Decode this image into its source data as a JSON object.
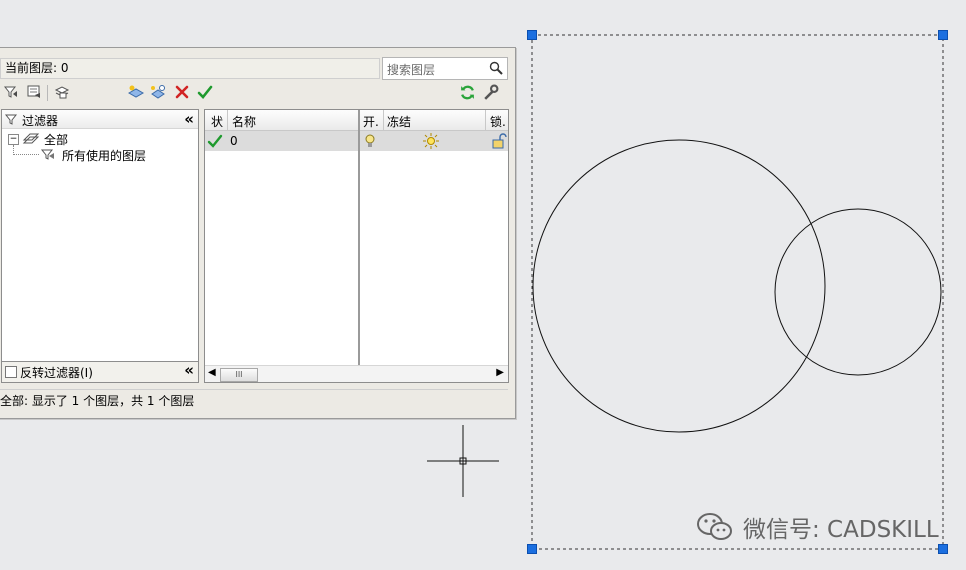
{
  "layer_manager": {
    "current_layer": "当前图层: 0",
    "search_placeholder": "搜索图层",
    "tree": {
      "header": "过滤器",
      "root": "全部",
      "child": "所有使用的图层",
      "invert_label": "反转过滤器(I)"
    },
    "list": {
      "columns": [
        "状",
        "名称",
        "开.",
        "冻结",
        "锁."
      ],
      "rows": [
        {
          "name": "0"
        }
      ]
    },
    "scroll_thumb": "III",
    "status": "全部: 显示了 1 个图层，共 1 个图层"
  },
  "drawing": {
    "circles": [
      {
        "label": "large-circle"
      },
      {
        "label": "small-circle"
      }
    ],
    "selection_color": "#1b6fe0"
  },
  "watermark": {
    "text": "微信号: CADSKILL"
  },
  "icons": [
    "new-property-filter-icon",
    "new-group-filter-icon",
    "layer-states-icon",
    "new-layer-icon",
    "new-layer-vp-frozen-icon",
    "delete-layer-icon",
    "set-current-icon",
    "refresh-icon",
    "settings-icon",
    "search-icon",
    "collapse-icon",
    "checkmark-icon",
    "bulb-icon",
    "sun-icon",
    "lock-icon"
  ]
}
